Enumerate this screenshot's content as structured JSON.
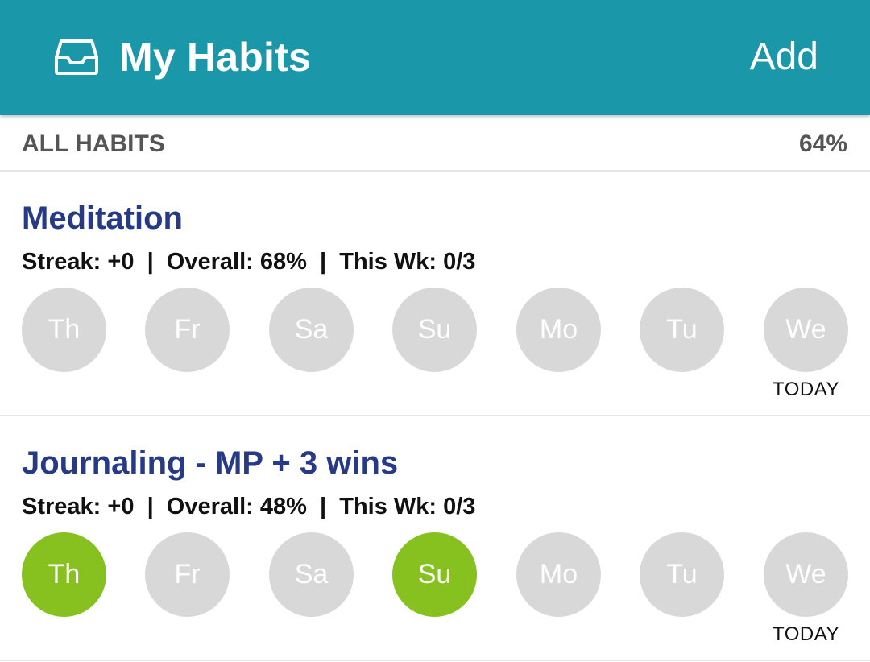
{
  "header": {
    "title": "My Habits",
    "add_label": "Add",
    "color": "#1b97aa"
  },
  "summary": {
    "label": "ALL HABITS",
    "value": "64%"
  },
  "colors": {
    "done": "#86c11f",
    "not_done": "#d8d8d8",
    "habit_title": "#263a85"
  },
  "habits": [
    {
      "name": "Meditation",
      "stats": "Streak: +0  |  Overall: 68%  |  This Wk: 0/3",
      "today_label": "TODAY",
      "days": [
        {
          "label": "Th",
          "done": false
        },
        {
          "label": "Fr",
          "done": false
        },
        {
          "label": "Sa",
          "done": false
        },
        {
          "label": "Su",
          "done": false
        },
        {
          "label": "Mo",
          "done": false
        },
        {
          "label": "Tu",
          "done": false
        },
        {
          "label": "We",
          "done": false
        }
      ]
    },
    {
      "name": "Journaling - MP + 3 wins",
      "stats": "Streak: +0  |  Overall: 48%  |  This Wk: 0/3",
      "today_label": "TODAY",
      "days": [
        {
          "label": "Th",
          "done": true
        },
        {
          "label": "Fr",
          "done": false
        },
        {
          "label": "Sa",
          "done": false
        },
        {
          "label": "Su",
          "done": true
        },
        {
          "label": "Mo",
          "done": false
        },
        {
          "label": "Tu",
          "done": false
        },
        {
          "label": "We",
          "done": false
        }
      ]
    }
  ]
}
